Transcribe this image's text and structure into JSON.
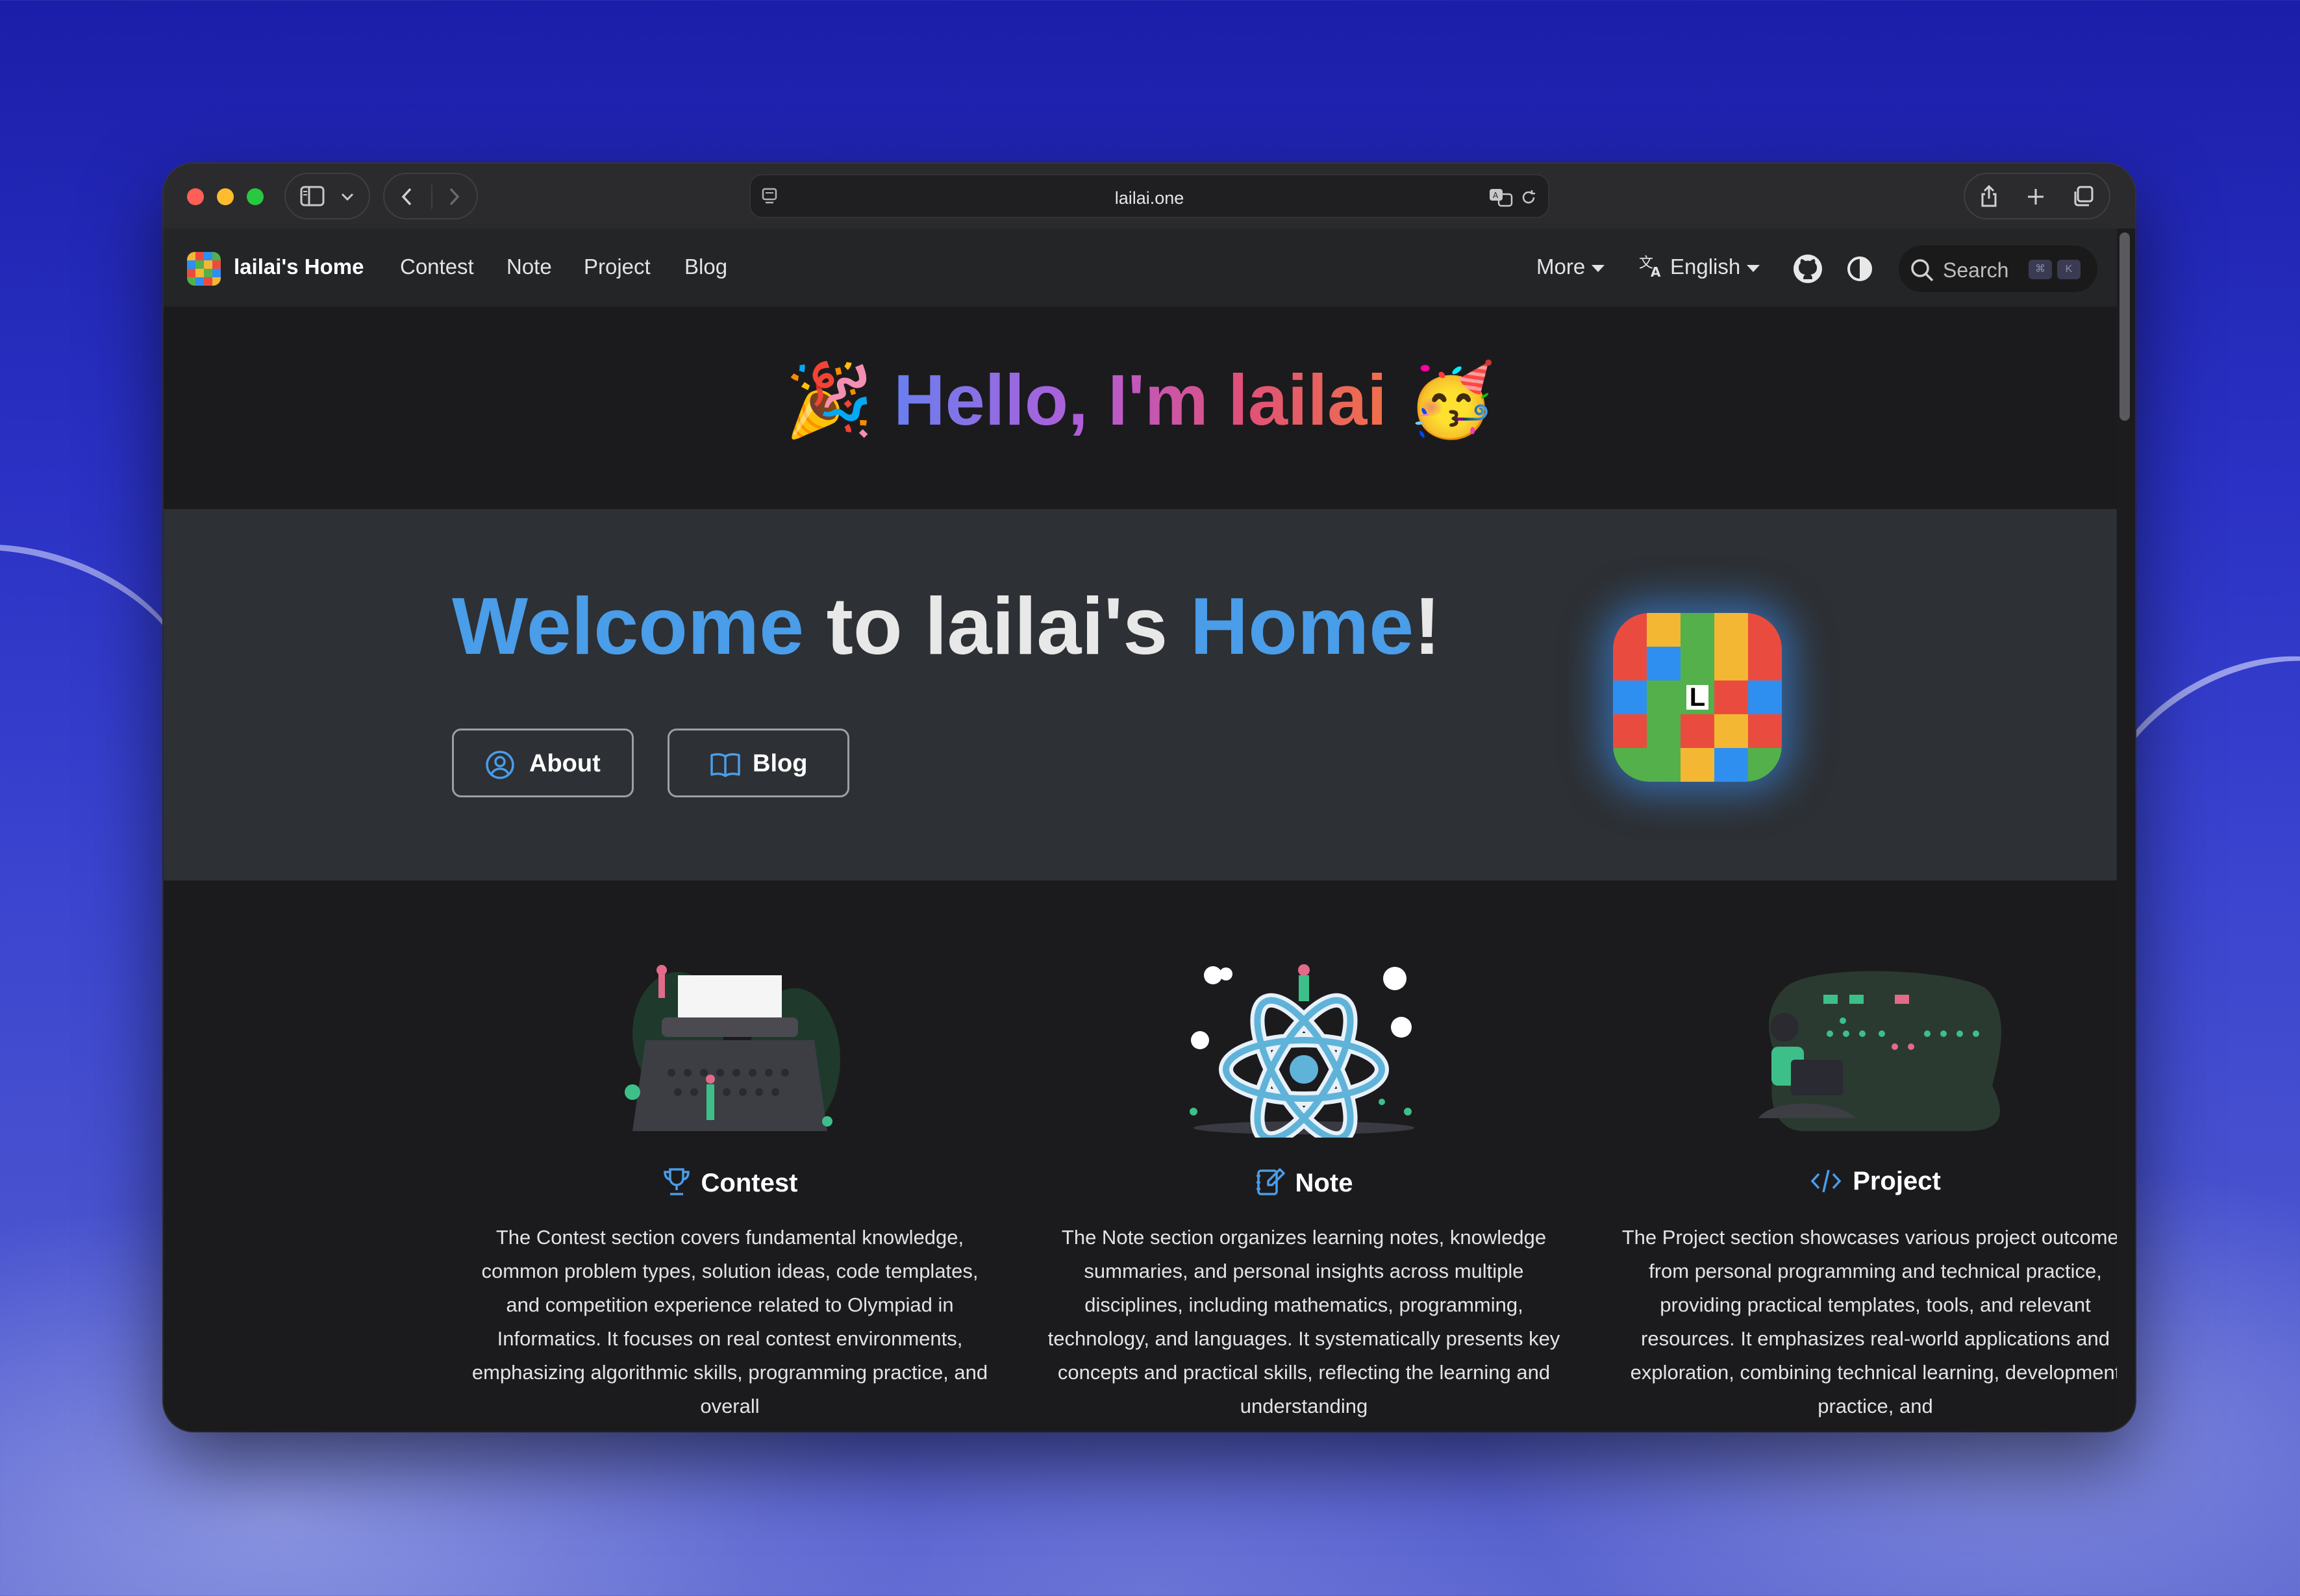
{
  "browser": {
    "url": "lailai.one"
  },
  "navbar": {
    "brand": "lailai's Home",
    "links": [
      "Contest",
      "Note",
      "Project",
      "Blog"
    ],
    "more_label": "More",
    "language_label": "English",
    "search_placeholder": "Search",
    "search_keys": [
      "⌘",
      "K"
    ]
  },
  "hero": {
    "greeting_left_emoji": "🎉",
    "greeting": "Hello, I'm lailai",
    "greeting_right_emoji": "🥳",
    "welcome_1": "Welcome",
    "welcome_2": " to lailai's ",
    "welcome_3": "Home",
    "welcome_4": "!",
    "about_label": "About",
    "blog_label": "Blog"
  },
  "features": [
    {
      "title": "Contest",
      "description": "The Contest section covers fundamental knowledge, common problem types, solution ideas, code templates, and competition experience related to Olympiad in Informatics. It focuses on real contest environments, emphasizing algorithmic skills, programming practice, and overall"
    },
    {
      "title": "Note",
      "description": "The Note section organizes learning notes, knowledge summaries, and personal insights across multiple disciplines, including mathematics, programming, technology, and languages. It systematically presents key concepts and practical skills, reflecting the learning and understanding"
    },
    {
      "title": "Project",
      "description": "The Project section showcases various project outcomes from personal programming and technical practice, providing practical templates, tools, and relevant resources. It emphasizes real-world applications and exploration, combining technical learning, development practice, and"
    }
  ],
  "colors": {
    "accent_blue": "#4a9de8",
    "navbar_bg": "#242526",
    "page_bg": "#1b1b1d",
    "hero_bg": "#2d3034"
  },
  "icons": [
    "sidebar-icon",
    "chevron-down-icon",
    "back-icon",
    "forward-icon",
    "reader-icon",
    "translate-icon",
    "reload-icon",
    "share-icon",
    "plus-icon",
    "tabs-icon",
    "translate-lang-icon",
    "github-icon",
    "theme-toggle-icon",
    "search-icon",
    "user-circle-icon",
    "book-icon",
    "trophy-icon",
    "edit-note-icon",
    "code-icon"
  ]
}
